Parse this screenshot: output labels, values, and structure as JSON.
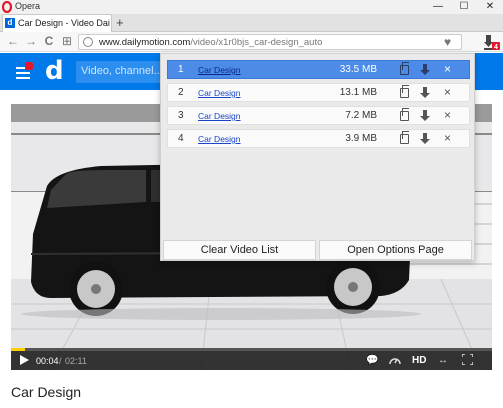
{
  "window": {
    "app_title": "Opera",
    "minimize": "—",
    "maximize": "☐",
    "close": "✕"
  },
  "tab": {
    "title": "Car Design - Video Dailymotion",
    "favicon": "d",
    "new_tab": "+"
  },
  "address_bar": {
    "back": "←",
    "forward": "→",
    "reload": "C",
    "speed_dial": "⊞",
    "url_domain": "www.dailymotion.com",
    "url_path": "/video/x1r0bjs_car-design_auto",
    "heart": "♥",
    "extension_badge": "4"
  },
  "site": {
    "logo": "d",
    "search_placeholder": "Video, channel...",
    "video_title": "Car Design"
  },
  "player": {
    "time_current": "00:04",
    "time_sep": "/",
    "time_total": "02:11",
    "progress_fraction": 0.03,
    "hd_label": "HD"
  },
  "popup": {
    "items": [
      {
        "num": "1",
        "title": "Car Design",
        "size": "33.5 MB",
        "active": true
      },
      {
        "num": "2",
        "title": "Car Design",
        "size": "13.1 MB",
        "active": false
      },
      {
        "num": "3",
        "title": "Car Design",
        "size": "7.2 MB",
        "active": false
      },
      {
        "num": "4",
        "title": "Car Design",
        "size": "3.9 MB",
        "active": false
      }
    ],
    "clear_label": "Clear Video List",
    "options_label": "Open Options Page"
  },
  "colors": {
    "brand_blue": "#0079ea",
    "active_row": "#4c8be8",
    "progress": "#ffcc00"
  }
}
